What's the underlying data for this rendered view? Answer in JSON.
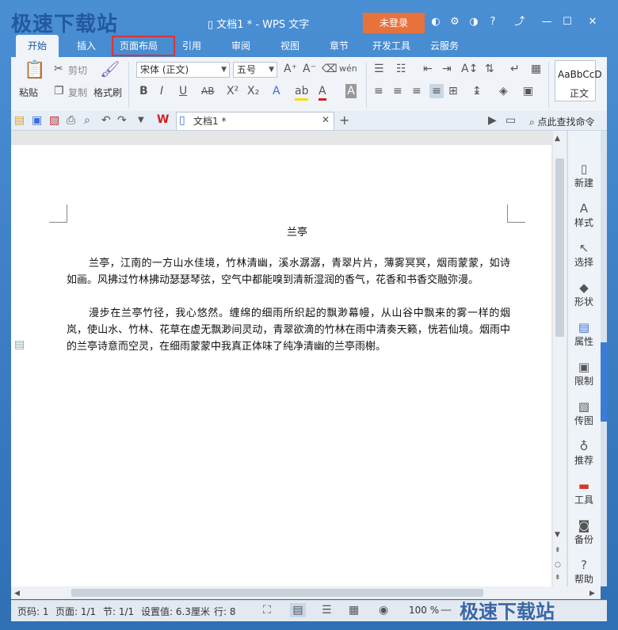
{
  "app": {
    "watermark_top": "极速下载站",
    "logo_text": "WPS · 文字",
    "title": "文档1 * - WPS 文字",
    "login_label": "未登录",
    "watermark_bottom": "极速下载站"
  },
  "tabs": [
    "开始",
    "插入",
    "页面布局",
    "引用",
    "审阅",
    "视图",
    "章节",
    "开发工具",
    "云服务"
  ],
  "ribbon": {
    "paste": "粘贴",
    "cut": "剪切",
    "copy": "复制",
    "format_painter": "格式刷",
    "font_name": "宋体 (正文)",
    "font_size": "五号",
    "style_preview": "AaBbCcD",
    "style_name": "正文"
  },
  "doc_tab": {
    "label": "文档1 *"
  },
  "search_cmd": "点此查找命令",
  "document": {
    "title": "兰亭",
    "paragraphs": [
      "兰亭，江南的一方山水佳境，竹林清幽，溪水潺潺，青翠片片，薄雾冥冥，烟雨蒙蒙，如诗如画。风拂过竹林拂动瑟瑟琴弦，空气中都能嗅到清新湿润的香气，花香和书香交融弥漫。",
      "漫步在兰亭竹径，我心悠然。缠绵的细雨所织起的飘渺幕幔，从山谷中飘来的雾一样的烟岚，使山水、竹林、花草在虚无飘渺间灵动，青翠欲滴的竹林在雨中清奏天籁，恍若仙境。烟雨中的兰亭诗意而空灵，在细雨蒙蒙中我真正体味了纯净清幽的兰亭雨榭。"
    ]
  },
  "side_panel": [
    "新建",
    "样式",
    "选择",
    "形状",
    "属性",
    "限制",
    "传图",
    "推荐",
    "工具",
    "备份",
    "帮助"
  ],
  "status": {
    "page_num": "页码: 1",
    "pages": "页面: 1/1",
    "section": "节: 1/1",
    "setting": "设置值: 6.3厘米",
    "row": "行: 8",
    "zoom": "100 %"
  }
}
